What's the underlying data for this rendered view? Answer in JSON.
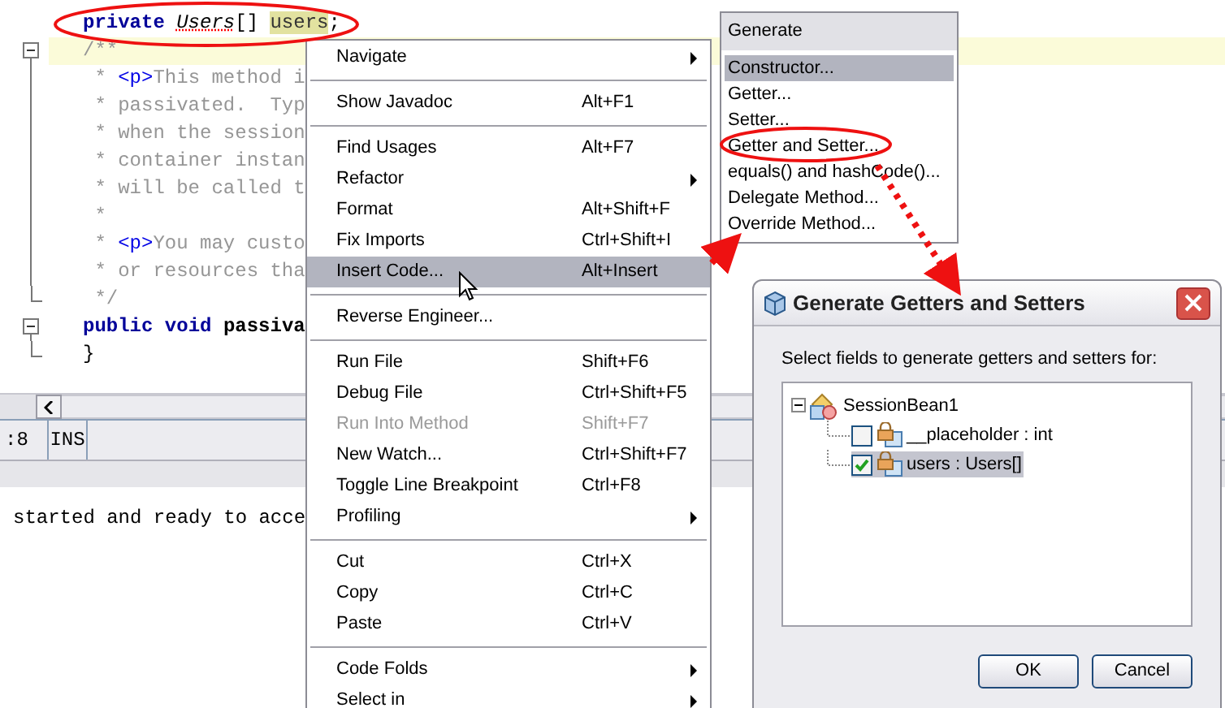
{
  "editor": {
    "code_lines": [
      {
        "current": false,
        "tokens": [
          {
            "kind": "keyword",
            "text": "private "
          },
          {
            "kind": "type",
            "text": "Users"
          },
          {
            "kind": "plain",
            "text": "[] "
          },
          {
            "kind": "highlight",
            "text": "users"
          },
          {
            "kind": "plain",
            "text": ";"
          }
        ]
      },
      {
        "fold": {
          "kind": "open"
        },
        "current": true,
        "tokens": [
          {
            "kind": "comment",
            "text": "/**"
          }
        ]
      },
      {
        "fold": {
          "kind": "inside"
        },
        "current": false,
        "tokens": [
          {
            "kind": "comment",
            "text": " * "
          },
          {
            "kind": "tag",
            "text": "<p>"
          },
          {
            "kind": "comment",
            "text": "This method i"
          }
        ]
      },
      {
        "fold": {
          "kind": "inside"
        },
        "current": false,
        "tokens": [
          {
            "kind": "comment",
            "text": " * passivated.  Typ"
          }
        ]
      },
      {
        "fold": {
          "kind": "inside"
        },
        "current": false,
        "tokens": [
          {
            "kind": "comment",
            "text": " * when the session"
          }
        ]
      },
      {
        "fold": {
          "kind": "inside"
        },
        "current": false,
        "tokens": [
          {
            "kind": "comment",
            "text": " * container instan"
          }
        ]
      },
      {
        "fold": {
          "kind": "inside"
        },
        "current": false,
        "tokens": [
          {
            "kind": "comment",
            "text": " * will be called t"
          }
        ]
      },
      {
        "fold": {
          "kind": "inside"
        },
        "current": false,
        "tokens": [
          {
            "kind": "comment",
            "text": " *"
          }
        ]
      },
      {
        "fold": {
          "kind": "inside"
        },
        "current": false,
        "tokens": [
          {
            "kind": "comment",
            "text": " * "
          },
          {
            "kind": "tag",
            "text": "<p>"
          },
          {
            "kind": "comment",
            "text": "You may custo"
          }
        ]
      },
      {
        "fold": {
          "kind": "inside"
        },
        "current": false,
        "tokens": [
          {
            "kind": "comment",
            "text": " * or resources tha"
          }
        ]
      },
      {
        "fold": {
          "kind": "close"
        },
        "current": false,
        "tokens": [
          {
            "kind": "comment",
            "text": " */"
          }
        ]
      },
      {
        "fold": {
          "kind": "open"
        },
        "current": false,
        "tokens": [
          {
            "kind": "keyword",
            "text": "public "
          },
          {
            "kind": "keyword",
            "text": "void "
          },
          {
            "kind": "method",
            "text": "passiva"
          }
        ]
      },
      {
        "fold": {
          "kind": "close"
        },
        "current": false,
        "tokens": [
          {
            "kind": "plain",
            "text": "}"
          }
        ]
      }
    ],
    "status": {
      "position": ":8",
      "mode": "INS"
    },
    "output_line": "started and ready to acce"
  },
  "context_menu": {
    "items": [
      {
        "kind": "item",
        "label": "Navigate",
        "submenu": true,
        "disabled": false,
        "selected": false
      },
      {
        "kind": "separator"
      },
      {
        "kind": "item",
        "label": "Show Javadoc",
        "shortcut": "Alt+F1",
        "submenu": false,
        "disabled": false,
        "selected": false
      },
      {
        "kind": "separator"
      },
      {
        "kind": "item",
        "label": "Find Usages",
        "shortcut": "Alt+F7",
        "submenu": false,
        "disabled": false,
        "selected": false
      },
      {
        "kind": "item",
        "label": "Refactor",
        "submenu": true,
        "disabled": false,
        "selected": false
      },
      {
        "kind": "item",
        "label": "Format",
        "shortcut": "Alt+Shift+F",
        "submenu": false,
        "disabled": false,
        "selected": false
      },
      {
        "kind": "item",
        "label": "Fix Imports",
        "shortcut": "Ctrl+Shift+I",
        "submenu": false,
        "disabled": false,
        "selected": false
      },
      {
        "kind": "item",
        "label": "Insert Code...",
        "shortcut": "Alt+Insert",
        "submenu": false,
        "disabled": false,
        "selected": true
      },
      {
        "kind": "separator"
      },
      {
        "kind": "item",
        "label": "Reverse Engineer...",
        "submenu": false,
        "disabled": false,
        "selected": false
      },
      {
        "kind": "separator"
      },
      {
        "kind": "item",
        "label": "Run File",
        "shortcut": "Shift+F6",
        "submenu": false,
        "disabled": false,
        "selected": false
      },
      {
        "kind": "item",
        "label": "Debug File",
        "shortcut": "Ctrl+Shift+F5",
        "submenu": false,
        "disabled": false,
        "selected": false
      },
      {
        "kind": "item",
        "label": "Run Into Method",
        "shortcut": "Shift+F7",
        "submenu": false,
        "disabled": true,
        "selected": false
      },
      {
        "kind": "item",
        "label": "New Watch...",
        "shortcut": "Ctrl+Shift+F7",
        "submenu": false,
        "disabled": false,
        "selected": false
      },
      {
        "kind": "item",
        "label": "Toggle Line Breakpoint",
        "shortcut": "Ctrl+F8",
        "submenu": false,
        "disabled": false,
        "selected": false
      },
      {
        "kind": "item",
        "label": "Profiling",
        "submenu": true,
        "disabled": false,
        "selected": false
      },
      {
        "kind": "separator"
      },
      {
        "kind": "item",
        "label": "Cut",
        "shortcut": "Ctrl+X",
        "submenu": false,
        "disabled": false,
        "selected": false
      },
      {
        "kind": "item",
        "label": "Copy",
        "shortcut": "Ctrl+C",
        "submenu": false,
        "disabled": false,
        "selected": false
      },
      {
        "kind": "item",
        "label": "Paste",
        "shortcut": "Ctrl+V",
        "submenu": false,
        "disabled": false,
        "selected": false
      },
      {
        "kind": "separator"
      },
      {
        "kind": "item",
        "label": "Code Folds",
        "submenu": true,
        "disabled": false,
        "selected": false
      },
      {
        "kind": "item",
        "label": "Select in",
        "submenu": true,
        "disabled": false,
        "selected": false
      }
    ]
  },
  "generate_popup": {
    "title": "Generate",
    "items": [
      {
        "label": "Constructor...",
        "selected": true
      },
      {
        "label": "Getter...",
        "selected": false
      },
      {
        "label": "Setter...",
        "selected": false
      },
      {
        "label": "Getter and Setter...",
        "selected": false
      },
      {
        "label": "equals() and hashCode()...",
        "selected": false
      },
      {
        "label": "Delegate Method...",
        "selected": false
      },
      {
        "label": "Override Method...",
        "selected": false
      }
    ]
  },
  "dialog": {
    "title": "Generate Getters and Setters",
    "prompt": "Select fields to generate getters and setters for:",
    "tree": {
      "label": "SessionBean1",
      "expanded": true,
      "children": [
        {
          "label": "__placeholder : int",
          "checked": false,
          "selected": false
        },
        {
          "label": "users : Users[]",
          "checked": true,
          "selected": true
        }
      ]
    },
    "buttons": [
      "OK",
      "Cancel"
    ]
  }
}
